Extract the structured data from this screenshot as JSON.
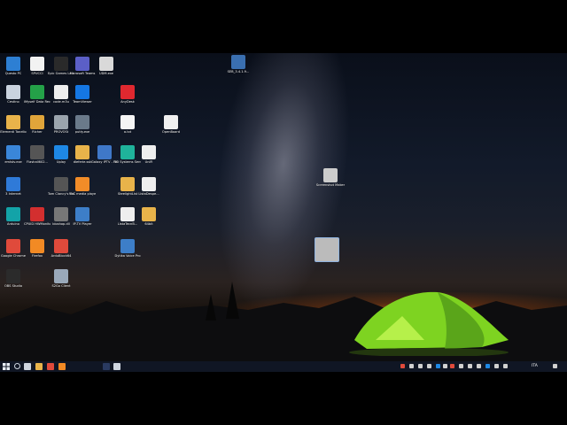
{
  "desktop": {
    "icons": [
      {
        "label": "Questo PC",
        "color": "#2d7fd3"
      },
      {
        "label": "SPUCCI",
        "color": "#f2f2f2"
      },
      {
        "label": "Epic Games Launcher",
        "color": "#2a2a2a"
      },
      {
        "label": "Microsoft Teams",
        "color": "#5b5fc7"
      },
      {
        "label": "UDM.exe",
        "color": "#d9d9d9"
      },
      {
        "label": "Cestino",
        "color": "#c9d3df"
      },
      {
        "label": "iMyself Data Recovery",
        "color": "#24a148"
      },
      {
        "label": "code.m3u",
        "color": "#eeeeee"
      },
      {
        "label": "TeamViewer",
        "color": "#1577e3"
      },
      {
        "label": "AnyDesk",
        "color": "#e0282f"
      },
      {
        "label": "Elementi Tonello",
        "color": "#e8b34a"
      },
      {
        "label": "Richer",
        "color": "#e0a53a"
      },
      {
        "label": "PROVOSt",
        "color": "#9aa4ad"
      },
      {
        "label": "putty.exe",
        "color": "#6a7a8a"
      },
      {
        "label": "a.txt",
        "color": "#f5f5f5"
      },
      {
        "label": "OpenBoard",
        "color": "#f0f0f0"
      },
      {
        "label": "emlstv.exe",
        "color": "#3a86d9"
      },
      {
        "label": "Flashall602...",
        "color": "#555555"
      },
      {
        "label": "Uplay",
        "color": "#1e88e5"
      },
      {
        "label": "dieferie.ssk",
        "color": "#e8b34a"
      },
      {
        "label": "Galaxy IPTV - Pattura #33...",
        "color": "#3f78c8"
      },
      {
        "label": "3D Systems Sense",
        "color": "#1fb39b"
      },
      {
        "label": "UniFi",
        "color": "#eeeeee"
      },
      {
        "label": "3 Internet",
        "color": "#2f7ad8"
      },
      {
        "label": "Tom Clancy's Rainbow Si...",
        "color": "#555555"
      },
      {
        "label": "VLC media player",
        "color": "#f28c28"
      },
      {
        "label": "SteelightList",
        "color": "#e8b34a"
      },
      {
        "label": "ListaDespe...",
        "color": "#eeeeee"
      },
      {
        "label": "Arduino",
        "color": "#13a3a8"
      },
      {
        "label": "CPUID HWMonitor",
        "color": "#d32f2f"
      },
      {
        "label": "bioshop.dll",
        "color": "#777777"
      },
      {
        "label": "IP-TV Player",
        "color": "#3d7ec8"
      },
      {
        "label": "ListaTecnB...",
        "color": "#eeeeee"
      },
      {
        "label": "64bit",
        "color": "#e8b34a"
      },
      {
        "label": "Google Chrome",
        "color": "#e04a3b"
      },
      {
        "label": "Firefox",
        "color": "#f28a24"
      },
      {
        "label": "ArduBlock64",
        "color": "#e04a3b"
      },
      {
        "label": "Dytika Voice Pro",
        "color": "#3d7ec8"
      },
      {
        "label": "OBS Studio",
        "color": "#2b2b2b"
      },
      {
        "label": "S2Go Client",
        "color": "#9aa9ba"
      }
    ],
    "center_icons": [
      {
        "label": "SEB_3.4.1.9...",
        "color": "#3a6fb0"
      },
      {
        "label": "Screenshot Maker",
        "color": "#cccccc"
      },
      {
        "label": "",
        "color": "#bbbbbb"
      }
    ]
  },
  "taskbar": {
    "apps": [
      {
        "name": "task-view",
        "color": "#cfd6e0"
      },
      {
        "name": "explorer",
        "color": "#e8b34a"
      },
      {
        "name": "chrome",
        "color": "#e04a3b"
      },
      {
        "name": "firefox",
        "color": "#f28a24"
      },
      {
        "name": "app",
        "color": "#2a3a60"
      },
      {
        "name": "unifi",
        "color": "#cfd6e0"
      }
    ],
    "tray_icons": [
      {
        "name": "tray-1",
        "color": "#e04a3b"
      },
      {
        "name": "tray-2",
        "color": "#d0d0d0"
      },
      {
        "name": "tray-3",
        "color": "#d0d0d0"
      },
      {
        "name": "tray-4",
        "color": "#d0d0d0"
      },
      {
        "name": "tray-5",
        "color": "#1e88e5"
      },
      {
        "name": "tray-6",
        "color": "#d0d0d0"
      },
      {
        "name": "tray-7",
        "color": "#e04a3b"
      },
      {
        "name": "tray-8",
        "color": "#d0d0d0"
      },
      {
        "name": "tray-9",
        "color": "#d0d0d0"
      },
      {
        "name": "tray-10",
        "color": "#d0d0d0"
      },
      {
        "name": "tray-11",
        "color": "#1e88e5"
      },
      {
        "name": "tray-12",
        "color": "#d0d0d0"
      },
      {
        "name": "tray-13",
        "color": "#d0d0d0"
      }
    ],
    "language": "ITA"
  }
}
